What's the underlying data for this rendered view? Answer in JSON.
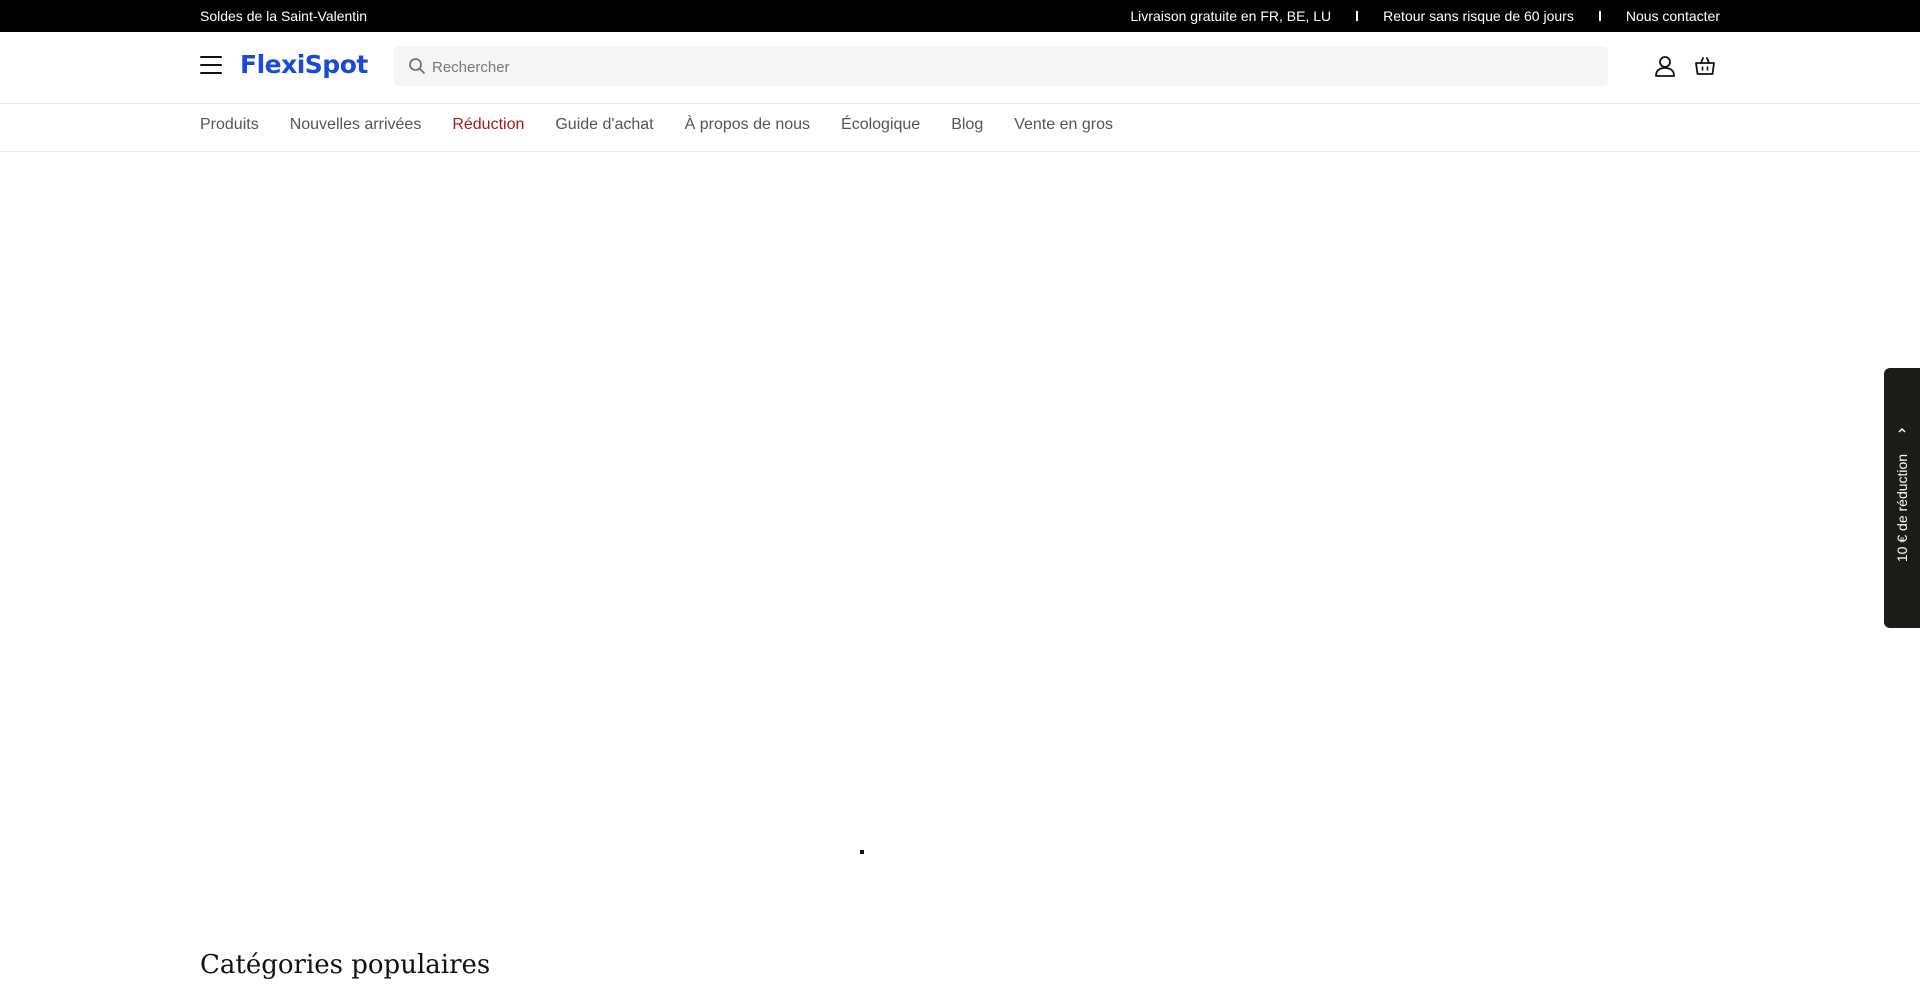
{
  "topbar": {
    "promo": "Soldes de la Saint-Valentin",
    "links": [
      "Livraison gratuite en FR, BE, LU",
      "Retour sans risque de 60 jours",
      "Nous contacter"
    ]
  },
  "header": {
    "logo": "FlexiSpot",
    "search_placeholder": "Rechercher"
  },
  "nav": {
    "items": [
      "Produits",
      "Nouvelles arrivées",
      "Réduction",
      "Guide d'achat",
      "À propos de nous",
      "Écologique",
      "Blog",
      "Vente en gros"
    ]
  },
  "main": {
    "section_title": "Catégories populaires"
  },
  "side_tab": {
    "label": "10 € de réduction"
  },
  "colors": {
    "brand": "#1a4bd8",
    "sale": "#a11d1d",
    "topbar": "#000000",
    "side_tab": "#1b1b17"
  }
}
